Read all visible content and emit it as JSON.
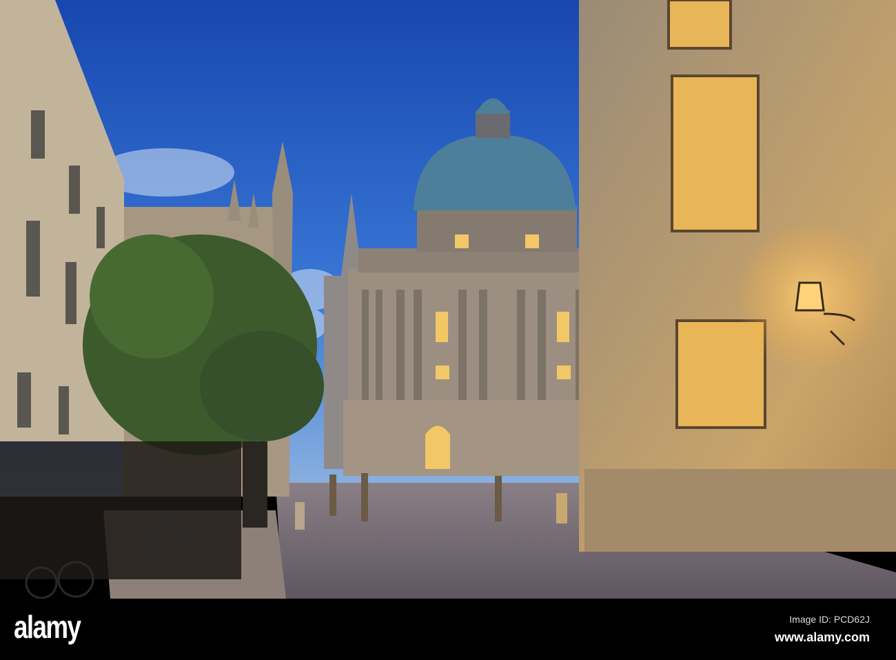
{
  "photo": {
    "subject": "Radcliffe Camera at dusk",
    "colors": {
      "sky_top": "#1a4fb8",
      "sky_bottom": "#7fa8dc",
      "stone": "#b9a88c",
      "lamp": "#ffc860",
      "road": "#6e6670"
    }
  },
  "watermark": {
    "logo": "alamy",
    "image_id": "Image ID: PCD62J",
    "website": "www.alamy.com"
  }
}
